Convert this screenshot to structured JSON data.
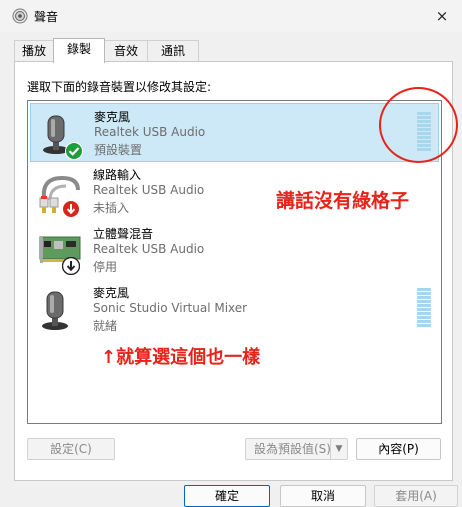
{
  "window": {
    "title": "聲音",
    "close_icon": "×"
  },
  "tabs": [
    {
      "label": "播放"
    },
    {
      "label": "錄製"
    },
    {
      "label": "音效"
    },
    {
      "label": "通訊"
    }
  ],
  "instruction": "選取下面的錄音裝置以修改其設定:",
  "devices": [
    {
      "name": "麥克風",
      "driver": "Realtek USB Audio",
      "status": "預設裝置",
      "icon": "microphone-icon",
      "badge": "check-badge-icon"
    },
    {
      "name": "線路輸入",
      "driver": "Realtek USB Audio",
      "status": "未插入",
      "icon": "line-in-cable-icon",
      "badge": "down-arrow-red-badge-icon"
    },
    {
      "name": "立體聲混音",
      "driver": "Realtek USB Audio",
      "status": "停用",
      "icon": "sound-card-icon",
      "badge": "down-arrow-black-badge-icon"
    },
    {
      "name": "麥克風",
      "driver": "Sonic Studio Virtual Mixer",
      "status": "就緒",
      "icon": "microphone-icon",
      "badge": ""
    }
  ],
  "buttons": {
    "configure": "設定(C)",
    "set_default": "設為預設值(S)",
    "properties": "內容(P)",
    "ok": "確定",
    "cancel": "取消",
    "apply": "套用(A)"
  },
  "annotations": {
    "no_bars": "講話沒有綠格子",
    "same_either": "↑就算選這個也一樣"
  },
  "colors": {
    "annotation": "#e8231a",
    "selection": "#cde8f7",
    "meter": "#a6d7ea",
    "accent": "#0067c0"
  }
}
